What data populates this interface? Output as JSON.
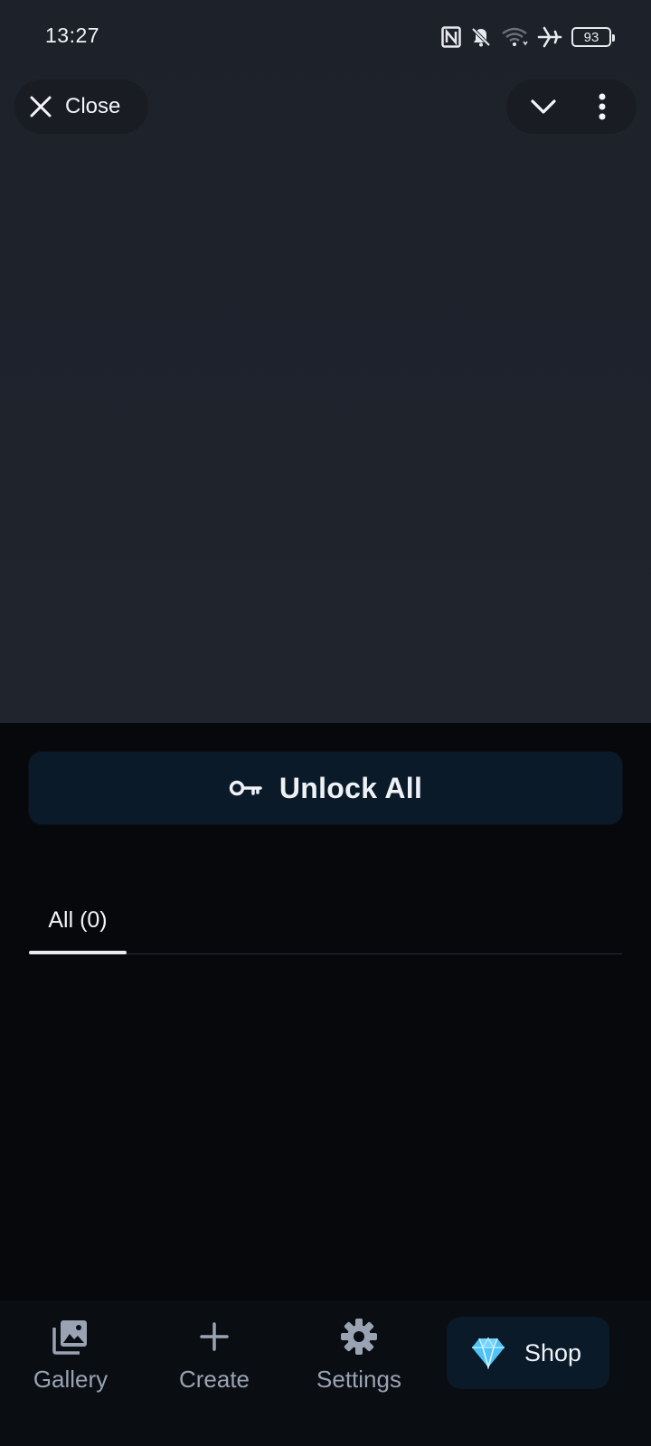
{
  "status_bar": {
    "time": "13:27",
    "icons": [
      "nfc-icon",
      "bell-off-icon",
      "wifi-icon",
      "airplane-icon",
      "battery-icon"
    ],
    "battery_level": "93"
  },
  "header": {
    "close_label": "Close",
    "close_icon": "close-icon",
    "collapse_icon": "chevron-down-icon",
    "more_icon": "more-vertical-icon"
  },
  "sheet": {
    "unlock_label": "Unlock All",
    "unlock_icon": "key-icon",
    "tabs": [
      {
        "label": "All (0)",
        "active": true
      }
    ]
  },
  "bottom_nav": {
    "items": [
      {
        "label": "Gallery",
        "icon": "gallery-icon"
      },
      {
        "label": "Create",
        "icon": "plus-icon"
      },
      {
        "label": "Settings",
        "icon": "gear-icon"
      }
    ],
    "shop": {
      "label": "Shop",
      "icon": "diamond-icon"
    }
  },
  "colors": {
    "top_background": "#1f232c",
    "sheet_background": "#06080c",
    "button_background": "#0b1a29",
    "nav_text": "#9aa3b3",
    "diamond": "#4fc3f7"
  }
}
